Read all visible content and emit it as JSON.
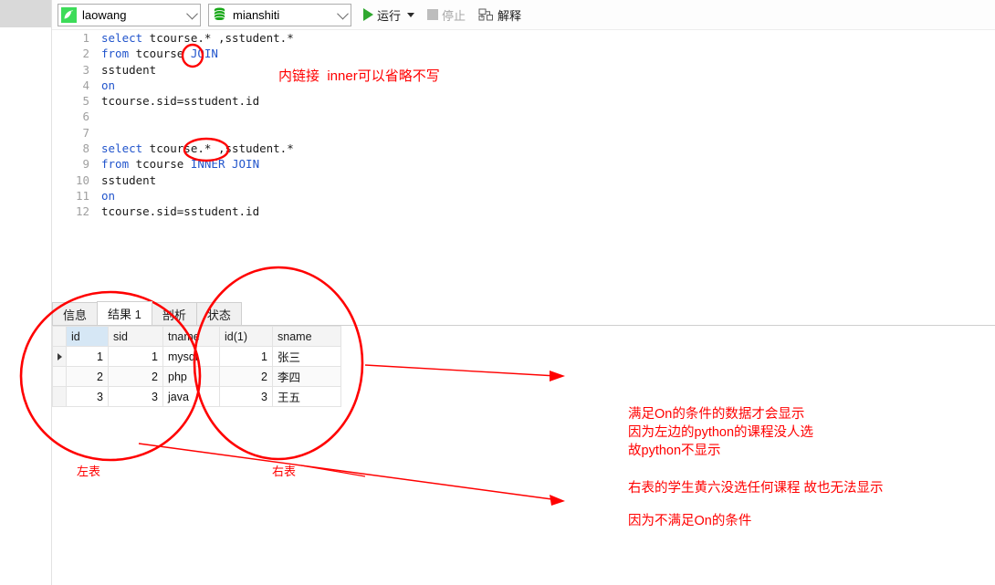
{
  "toolbar": {
    "connection": {
      "icon": "bird-logo-icon",
      "value": "laowang"
    },
    "database": {
      "icon": "database-icon",
      "value": "mianshiti"
    },
    "run_label": "运行",
    "stop_label": "停止",
    "explain_label": "解释"
  },
  "editor": {
    "lines": [
      {
        "no": "1",
        "tokens": [
          {
            "t": "select",
            "k": true
          },
          {
            "t": " tcourse.* ,sstudent.*",
            "k": false
          }
        ]
      },
      {
        "no": "2",
        "tokens": [
          {
            "t": "from",
            "k": true
          },
          {
            "t": " tcourse ",
            "k": false
          },
          {
            "t": "JOIN",
            "k": true
          }
        ]
      },
      {
        "no": "3",
        "tokens": [
          {
            "t": "sstudent",
            "k": false
          }
        ]
      },
      {
        "no": "4",
        "tokens": [
          {
            "t": "on",
            "k": true
          }
        ]
      },
      {
        "no": "5",
        "tokens": [
          {
            "t": "tcourse.sid=sstudent.id",
            "k": false
          }
        ]
      },
      {
        "no": "6",
        "tokens": [
          {
            "t": "",
            "k": false
          }
        ]
      },
      {
        "no": "7",
        "tokens": [
          {
            "t": "",
            "k": false
          }
        ]
      },
      {
        "no": "8",
        "tokens": [
          {
            "t": "select",
            "k": true
          },
          {
            "t": " tcourse.* ,sstudent.*",
            "k": false
          }
        ]
      },
      {
        "no": "9",
        "tokens": [
          {
            "t": "from",
            "k": true
          },
          {
            "t": " tcourse ",
            "k": false
          },
          {
            "t": "INNER JOIN",
            "k": true
          }
        ]
      },
      {
        "no": "10",
        "tokens": [
          {
            "t": "sstudent",
            "k": false
          }
        ]
      },
      {
        "no": "11",
        "tokens": [
          {
            "t": "on",
            "k": true
          }
        ]
      },
      {
        "no": "12",
        "tokens": [
          {
            "t": "tcourse.sid=sstudent.id",
            "k": false
          }
        ]
      }
    ]
  },
  "results": {
    "tabs": [
      {
        "label": "信息",
        "active": false
      },
      {
        "label": "结果 1",
        "active": true
      },
      {
        "label": "剖析",
        "active": false
      },
      {
        "label": "状态",
        "active": false
      }
    ],
    "columns": [
      "id",
      "sid",
      "tname",
      "id(1)",
      "sname"
    ],
    "selected_column": "id",
    "rows": [
      {
        "marker": true,
        "id": "1",
        "sid": "1",
        "tname": "mysql",
        "id1": "1",
        "sname": "张三"
      },
      {
        "marker": false,
        "id": "2",
        "sid": "2",
        "tname": "php",
        "id1": "2",
        "sname": "李四"
      },
      {
        "marker": false,
        "id": "3",
        "sid": "3",
        "tname": "java",
        "id1": "3",
        "sname": "王五"
      }
    ]
  },
  "annotations": {
    "color": "#ff0000",
    "inner_note": "内链接  inner可以省略不写",
    "left_table_label": "左表",
    "right_table_label": "右表",
    "note_block_1": "满足On的条件的数据才会显示\n因为左边的python的课程没人选\n故python不显示",
    "note_block_2": "右表的学生黄六没选任何课程 故也无法显示",
    "note_block_3": "因为不满足On的条件"
  }
}
